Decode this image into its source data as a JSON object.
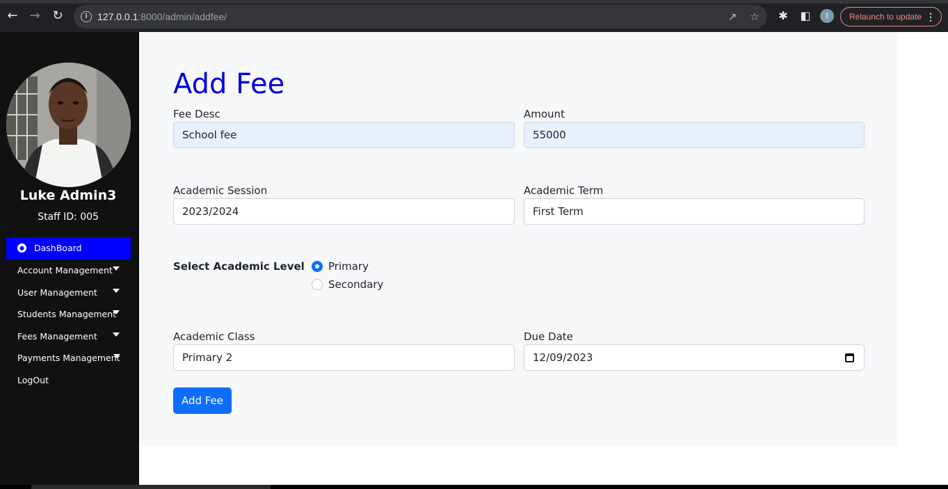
{
  "browser": {
    "url_host": "127.0.0.1",
    "url_path": ":8000/admin/addfee/",
    "profile_initial": "I",
    "relaunch_label": "Relaunch to update"
  },
  "sidebar": {
    "user_name": "Luke Admin3",
    "staff_id": "Staff ID: 005",
    "items": [
      {
        "label": "DashBoard",
        "icon": "dashboard-icon"
      },
      {
        "label": "Account Management"
      },
      {
        "label": "User Management"
      },
      {
        "label": "Students Management"
      },
      {
        "label": "Fees Management"
      },
      {
        "label": "Payments Management"
      },
      {
        "label": "LogOut"
      }
    ]
  },
  "form": {
    "title": "Add Fee",
    "fee_desc_label": "Fee Desc",
    "fee_desc_value": "School fee",
    "amount_label": "Amount",
    "amount_value": "55000",
    "session_label": "Academic Session",
    "session_value": "2023/2024",
    "term_label": "Academic Term",
    "term_value": "First Term",
    "level_label": "Select Academic Level",
    "level_options": [
      "Primary",
      "Secondary"
    ],
    "level_selected": "Primary",
    "class_label": "Academic Class",
    "class_value": "Primary 2",
    "due_label": "Due Date",
    "due_value": "12/09/2023",
    "submit_label": "Add Fee"
  },
  "colors": {
    "accent": "#0000ff",
    "title": "#0000dd",
    "primary_button": "#0d6efd",
    "sidebar_bg": "#111111"
  }
}
